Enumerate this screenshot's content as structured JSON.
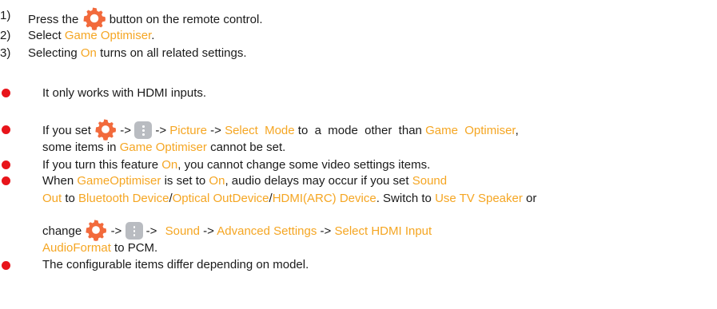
{
  "steps": [
    {
      "num": "1)",
      "pre": "Press the",
      "post": "button on the remote control."
    },
    {
      "num": "2)",
      "pre": "Select",
      "hl": "Game Optimiser",
      "post": "."
    },
    {
      "num": "3)",
      "pre": "Selecting",
      "hl": "On",
      "post": "turns on all related settings."
    }
  ],
  "notes": {
    "n1": "It only works with HDMI inputs.",
    "n2": {
      "arrow": "->",
      "picture": "Picture",
      "select_mode": "Select  Mode",
      "to_a_mode": "to  a  mode  other  than",
      "game_optimiser": "Game  Optimiser",
      "comma": ",",
      "line2_pre": "some items in",
      "line2_hl": "Game Optimiser",
      "line2_post": "cannot be set.",
      "lead": "If  you  set"
    },
    "n3": {
      "pre": "If you turn this feature",
      "hl": "On",
      "post": ", you cannot change some video settings items."
    },
    "n4": {
      "when": "When",
      "gameoptimiser": "GameOptimiser",
      "is_set_to": "is set to",
      "on": "On",
      "audio": ", audio delays may occur if you set",
      "sound": "Sound",
      "out": "Out",
      "to": "to",
      "bt": "Bluetooth Device",
      "slash1": "/",
      "optical": "Optical OutDevice",
      "slash2": "/",
      "hdmi_arc": "HDMI(ARC) Device",
      "switch": ". Switch to",
      "use_tv": "Use TV Speaker",
      "or": "or",
      "change": "change",
      "arrow": "->",
      "sound2": "Sound",
      "advanced": "Advanced Settings",
      "select_hdmi": "Select HDMI Input",
      "audioformat": "AudioFormat",
      "to_pcm": "to PCM."
    },
    "n5": "The configurable items differ depending on model."
  },
  "colors": {
    "highlight": "#f5a623",
    "bullet": "#e8141a",
    "gear": "#f26a3c"
  },
  "icons": {
    "settings": "settings-gear-icon",
    "more": "more-options-icon"
  }
}
